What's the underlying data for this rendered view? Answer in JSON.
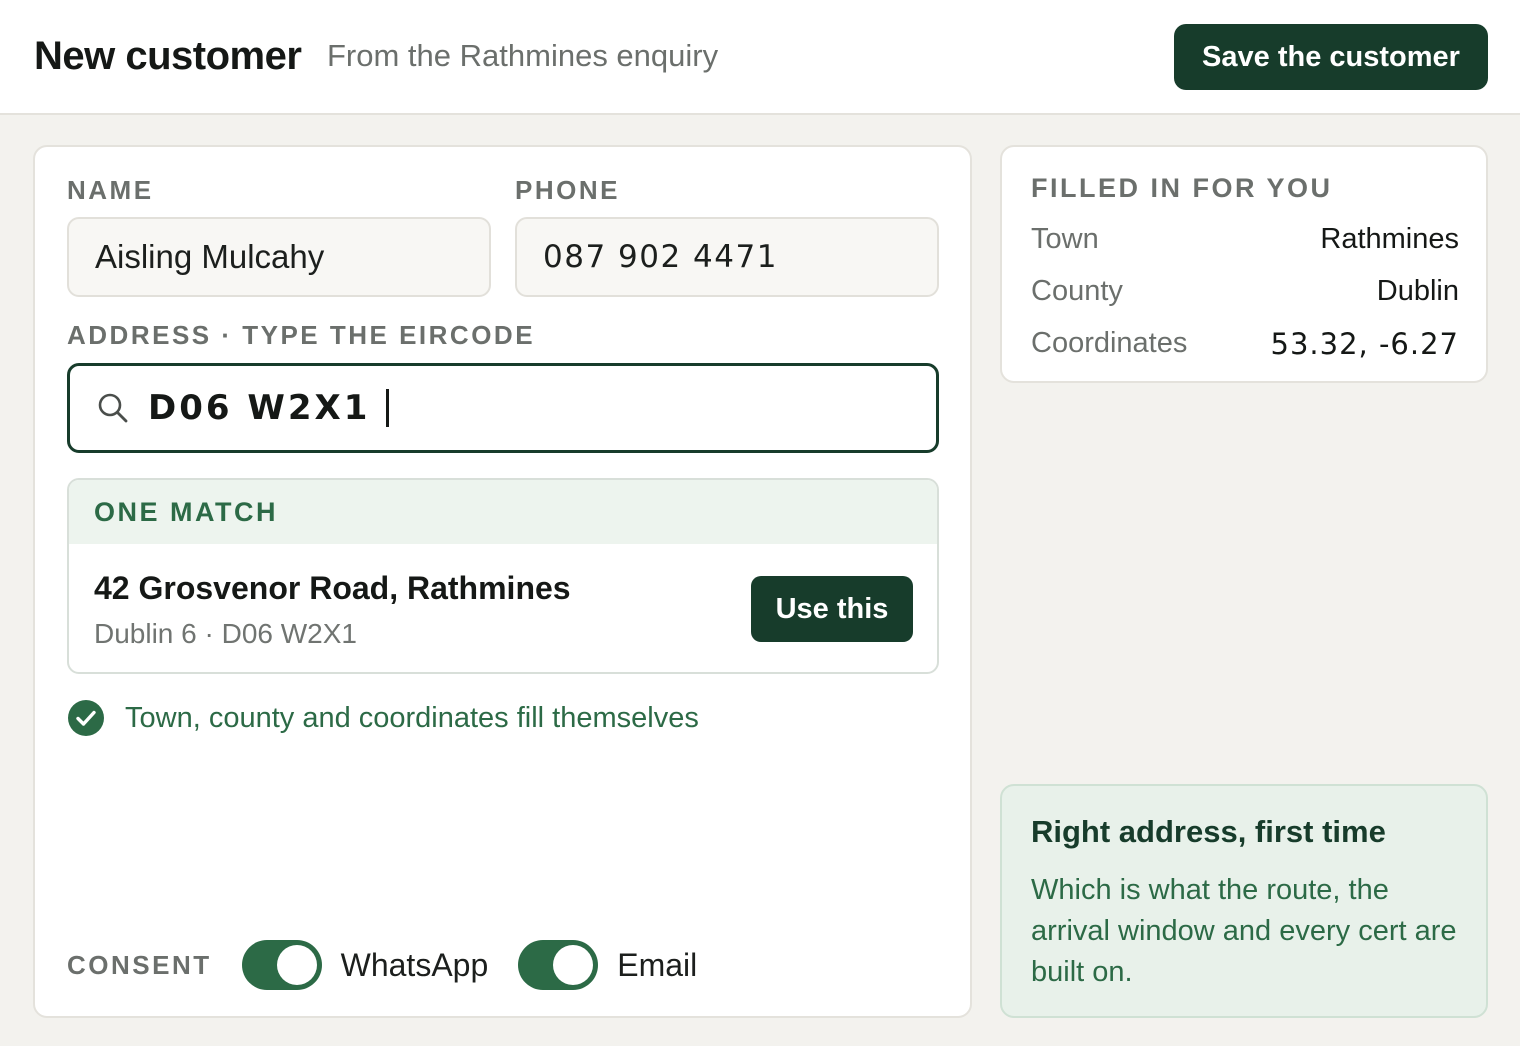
{
  "header": {
    "title": "New customer",
    "subtitle": "From the Rathmines enquiry",
    "save_label": "Save the customer"
  },
  "form": {
    "name_label": "NAME",
    "name_value": "Aisling Mulcahy",
    "phone_label": "PHONE",
    "phone_value": "087 902 4471",
    "address_label": "ADDRESS · TYPE THE EIRCODE",
    "eircode_value": "D06 W2X1",
    "match": {
      "heading": "ONE MATCH",
      "street": "42 Grosvenor Road, Rathmines",
      "detail": "Dublin 6 · D06 W2X1",
      "use_label": "Use this"
    },
    "autofill_note": "Town, county and coordinates fill themselves",
    "consent": {
      "label": "CONSENT",
      "options": [
        {
          "label": "WhatsApp",
          "on": true
        },
        {
          "label": "Email",
          "on": true
        }
      ]
    }
  },
  "filled": {
    "title": "FILLED IN FOR YOU",
    "rows": [
      {
        "key": "Town",
        "value": "Rathmines"
      },
      {
        "key": "County",
        "value": "Dublin"
      },
      {
        "key": "Coordinates",
        "value": "53.32, -6.27"
      }
    ]
  },
  "tip": {
    "title": "Right address, first time",
    "body": "Which is what the route, the arrival window and every cert are built on."
  },
  "colors": {
    "accent": "#173c2b",
    "success": "#2c6a46",
    "background": "#f3f2ee"
  },
  "icons": {
    "search": "search-icon",
    "check": "check-circle-icon"
  }
}
